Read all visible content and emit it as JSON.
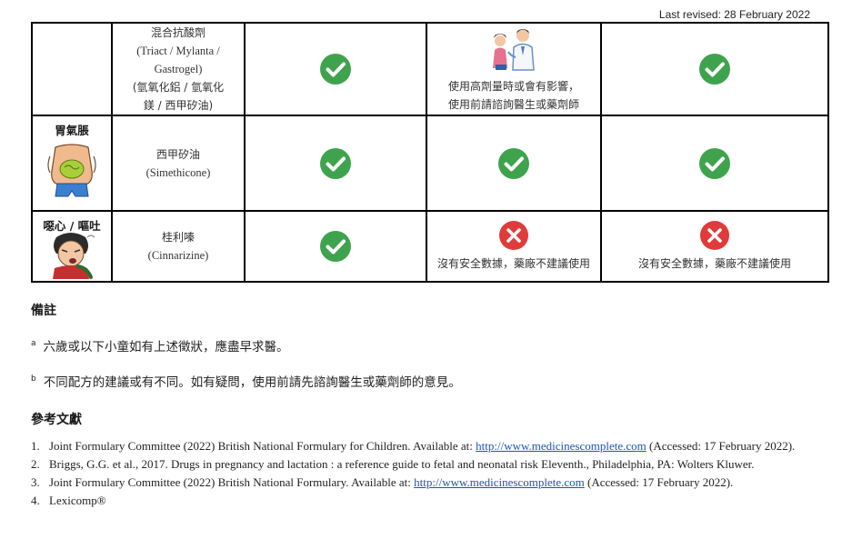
{
  "header": {
    "last_revised": "Last revised: 28 February 2022"
  },
  "table": {
    "rows": [
      {
        "symptom": "",
        "drug_lines": [
          "混合抗酸劑",
          "(Triact / Mylanta /",
          "Gastrogel)",
          "(氫氧化鋁 / 氫氧化",
          "鎂 / 西甲矽油)"
        ],
        "col1": {
          "status": "check"
        },
        "col2": {
          "status": "doctor",
          "note_lines": [
            "使用高劑量時或會有影響，",
            "使用前請諮詢醫生或藥劑師"
          ]
        },
        "col3": {
          "status": "check"
        }
      },
      {
        "symptom": "胃氣脹",
        "drug_lines": [
          "西甲矽油",
          "(Simethicone)"
        ],
        "col1": {
          "status": "check"
        },
        "col2": {
          "status": "check"
        },
        "col3": {
          "status": "check"
        }
      },
      {
        "symptom": "噁心 / 嘔吐",
        "drug_lines": [
          "桂利嗪",
          "(Cinnarizine)"
        ],
        "col1": {
          "status": "check"
        },
        "col2": {
          "status": "cross",
          "note": "沒有安全數據，藥廠不建議使用"
        },
        "col3": {
          "status": "cross",
          "note": "沒有安全數據，藥廠不建議使用"
        }
      }
    ]
  },
  "remarks": {
    "title": "備註",
    "items": [
      {
        "mark": "a",
        "text": "六歲或以下小童如有上述徵狀，應盡早求醫。"
      },
      {
        "mark": "b",
        "text": "不同配方的建議或有不同。如有疑問，使用前請先諮詢醫生或藥劑師的意見。"
      }
    ]
  },
  "references": {
    "title": "參考文獻",
    "items": [
      {
        "num": "1.",
        "before": "Joint Formulary Committee (2022) British National Formulary for Children. Available at: ",
        "link": "http://www.medicinescomplete.com",
        "after": " (Accessed: 17 February 2022)."
      },
      {
        "num": "2.",
        "before": "Briggs, G.G. et al., 2017. Drugs in pregnancy and lactation : a reference guide to fetal and neonatal risk Eleventh., Philadelphia, PA: Wolters Kluwer.",
        "link": "",
        "after": ""
      },
      {
        "num": "3.",
        "before": "Joint Formulary Committee (2022) British National Formulary. Available at: ",
        "link": "http://www.medicinescomplete.com",
        "after": " (Accessed: 17 February 2022)."
      },
      {
        "num": "4.",
        "before": "Lexicomp®",
        "link": "",
        "after": ""
      }
    ]
  },
  "colors": {
    "check": "#3fa34d",
    "cross": "#e03b3b",
    "link": "#1a55b8"
  }
}
